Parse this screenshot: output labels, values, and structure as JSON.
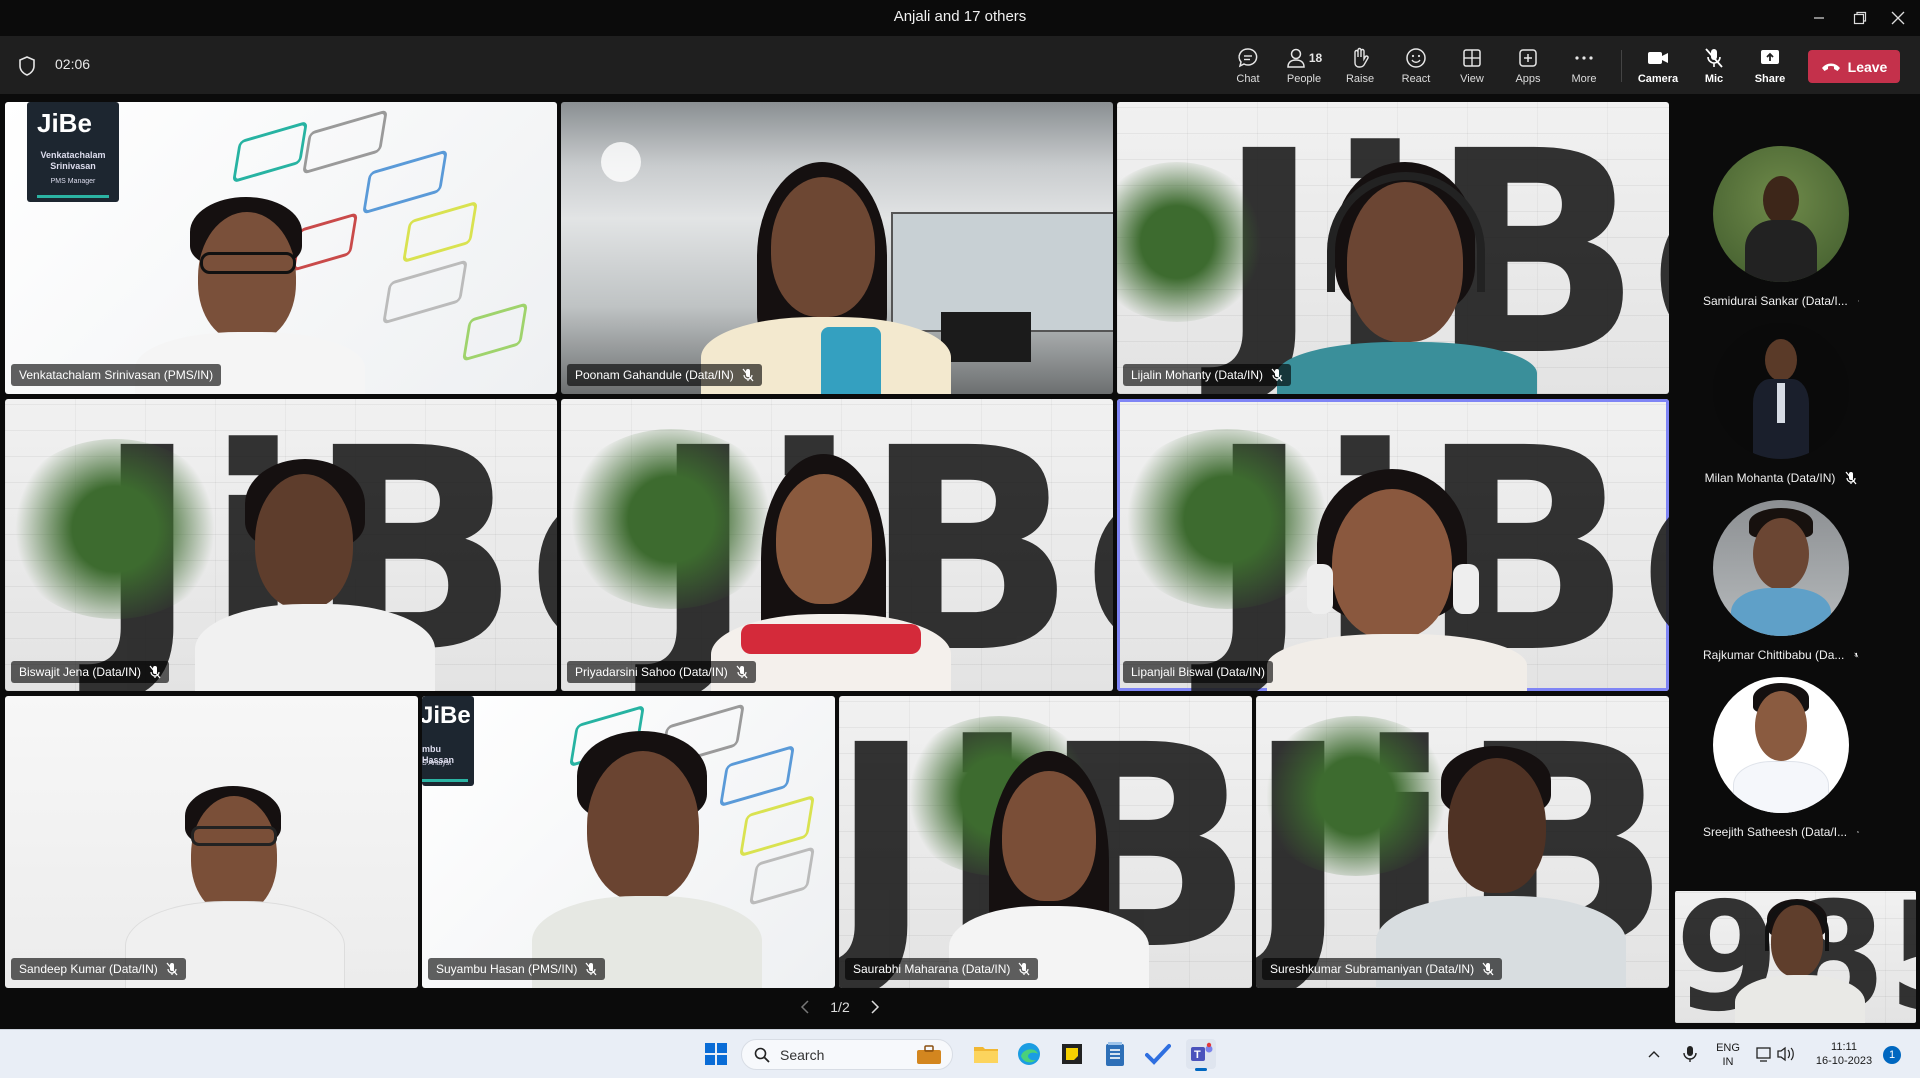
{
  "window": {
    "title": "Anjali and 17 others"
  },
  "toolbar": {
    "timer": "02:06",
    "buttons": {
      "chat": "Chat",
      "people": "People",
      "people_count": "18",
      "raise": "Raise",
      "react": "React",
      "view": "View",
      "apps": "Apps",
      "more": "More",
      "camera": "Camera",
      "mic": "Mic",
      "share": "Share"
    },
    "leave": "Leave"
  },
  "tiles": [
    {
      "name": "Venkatachalam Srinivasan (PMS/IN)",
      "muted": false,
      "bg": "jibe",
      "card_title": "Venkatachalam\nSrinivasan",
      "card_role": "PMS Manager"
    },
    {
      "name": "Poonam Gahandule (Data/IN)",
      "muted": true,
      "bg": "office"
    },
    {
      "name": "Lijalin Mohanty (Data/IN)",
      "muted": true,
      "bg": "brick"
    },
    {
      "name": "Biswajit Jena (Data/IN)",
      "muted": true,
      "bg": "brick"
    },
    {
      "name": "Priyadarsini Sahoo (Data/IN)",
      "muted": true,
      "bg": "brick"
    },
    {
      "name": "Lipanjali Biswal (Data/IN)",
      "muted": false,
      "bg": "brick",
      "active": true
    },
    {
      "name": "Sandeep Kumar (Data/IN)",
      "muted": true,
      "bg": "white"
    },
    {
      "name": "Suyambu Hasan (PMS/IN)",
      "muted": true,
      "bg": "jibe",
      "card_title": "mbu Hassan",
      "card_role": "S Analyst"
    },
    {
      "name": "Saurabhi Maharana (Data/IN)",
      "muted": true,
      "bg": "brick"
    },
    {
      "name": "Sureshkumar Subramaniyan (Data/IN)",
      "muted": true,
      "bg": "brick"
    }
  ],
  "brand": {
    "logo_text": "JiBe",
    "wall_text": "JiBe",
    "self_wall_text": "985"
  },
  "pager": {
    "text": "1/2"
  },
  "rail": [
    {
      "name": "Samidurai Sankar (Data/I...",
      "muted": true
    },
    {
      "name": "Milan Mohanta (Data/IN)",
      "muted": true
    },
    {
      "name": "Rajkumar Chittibabu (Da...",
      "muted": true
    },
    {
      "name": "Sreejith Satheesh (Data/I...",
      "muted": true
    }
  ],
  "taskbar": {
    "search_placeholder": "Search",
    "lang_top": "ENG",
    "lang_bottom": "IN",
    "time": "11:11",
    "date": "16-10-2023",
    "notification_count": "1"
  },
  "colors": {
    "leave": "#c4314b",
    "active_tile": "#7f85f5",
    "toolbar": "#1f1f1f"
  }
}
